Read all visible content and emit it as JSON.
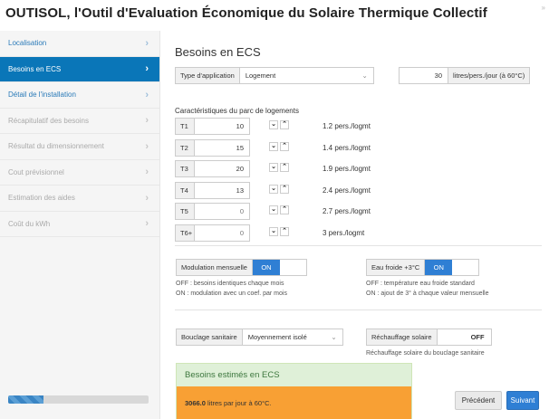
{
  "app": {
    "title": "OUTISOL, l'Outil d'Evaluation Économique du Solaire Thermique Collectif",
    "corner_mark": "»"
  },
  "sidebar": {
    "items": [
      {
        "label": "Localisation",
        "state": "link"
      },
      {
        "label": "Besoins en ECS",
        "state": "active"
      },
      {
        "label": "Détail de l'installation",
        "state": "link"
      },
      {
        "label": "Récapitulatif des besoins",
        "state": "disabled"
      },
      {
        "label": "Résultat du dimensionnement",
        "state": "disabled"
      },
      {
        "label": "Cout prévisionnel",
        "state": "disabled"
      },
      {
        "label": "Estimation des aides",
        "state": "disabled"
      },
      {
        "label": "Coût du kWh",
        "state": "disabled"
      }
    ],
    "chevron": "›",
    "progress_fraction": 0.25
  },
  "main": {
    "section_title": "Besoins en ECS",
    "type_app": {
      "label": "Type d'application",
      "value": "Logement",
      "caret": "⌄"
    },
    "liters": {
      "value": "30",
      "unit": "litres/pers./jour (à 60°C)"
    },
    "caract_label": "Caractéristiques du parc de logements",
    "logements": [
      {
        "type": "T1",
        "value": "10",
        "pers": "1.2 pers./logmt"
      },
      {
        "type": "T2",
        "value": "15",
        "pers": "1.4 pers./logmt"
      },
      {
        "type": "T3",
        "value": "20",
        "pers": "1.9 pers./logmt"
      },
      {
        "type": "T4",
        "value": "13",
        "pers": "2.4 pers./logmt"
      },
      {
        "type": "T5",
        "value": "0",
        "pers": "2.7 pers./logmt"
      },
      {
        "type": "T6+",
        "value": "0",
        "pers": "3 pers./logmt"
      }
    ],
    "stepper": {
      "down": "⌄",
      "up": "⌃"
    },
    "modulation": {
      "label": "Modulation mensuelle",
      "state": "ON",
      "help_off": "OFF : besoins identiques chaque mois",
      "help_on": "ON : modulation avec un coef. par mois"
    },
    "eau_froide": {
      "label": "Eau froide +3°C",
      "state": "ON",
      "help_off": "OFF : température eau froide standard",
      "help_on": "ON : ajout de 3° à chaque valeur mensuelle"
    },
    "bouclage": {
      "label": "Bouclage sanitaire",
      "value": "Moyennement isolé",
      "caret": "⌄"
    },
    "rechauffage": {
      "label": "Réchauffage solaire",
      "state": "OFF",
      "help": "Réchauffage solaire du bouclage sanitaire"
    },
    "result": {
      "title": "Besoins estimés en ECS",
      "value": "3066.0",
      "text": " litres par jour à 60°C."
    },
    "buttons": {
      "prev": "Précédent",
      "next": "Suivant"
    }
  },
  "colors": {
    "accent": "#0a76b8",
    "toggle_on": "#2f7fd4",
    "result_head": "#dff0d8",
    "result_body": "#f8a034"
  }
}
